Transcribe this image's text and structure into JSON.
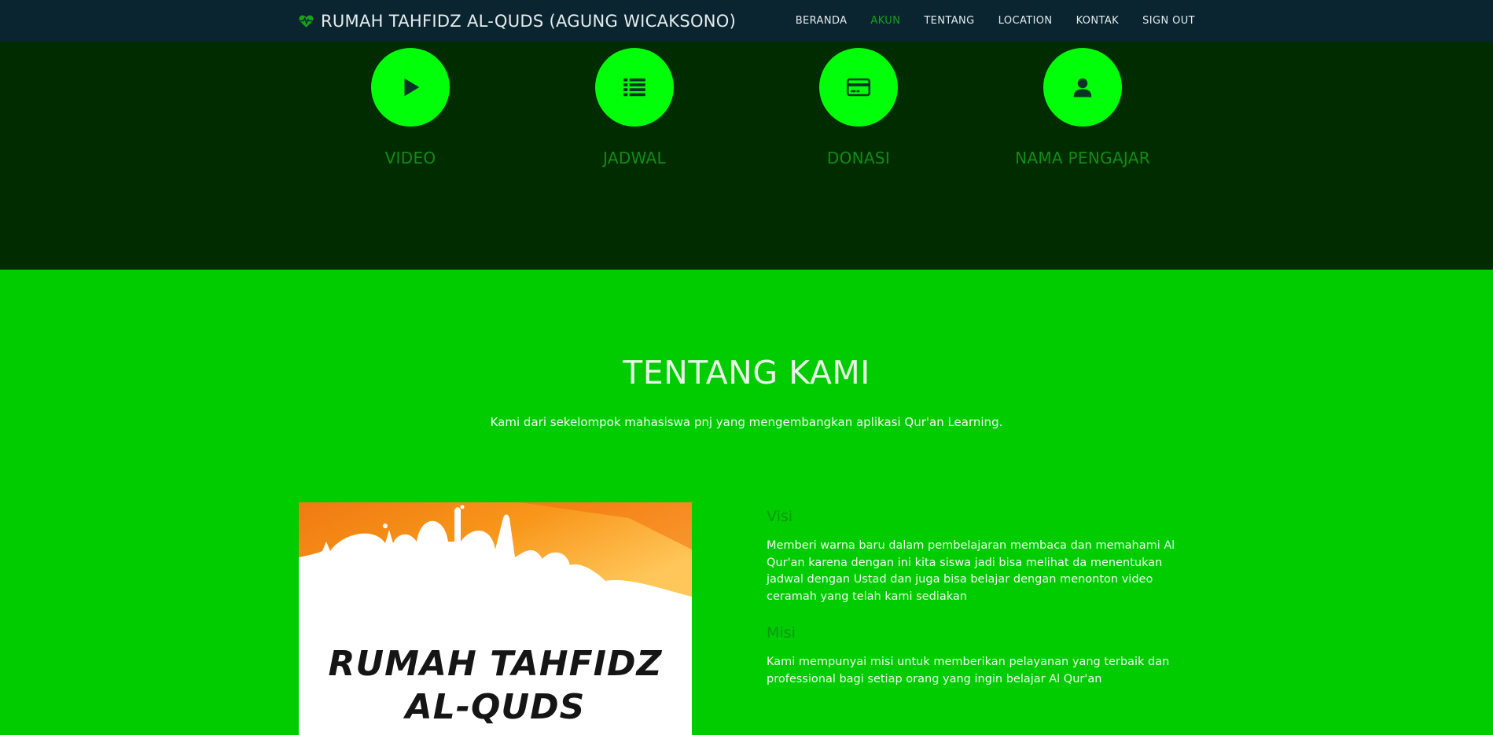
{
  "navbar": {
    "brand": "RUMAH TAHFIDZ AL-QUDS (AGUNG WICAKSONO)",
    "links": [
      {
        "label": "BERANDA",
        "active": false
      },
      {
        "label": "AKUN",
        "active": true
      },
      {
        "label": "TENTANG",
        "active": false
      },
      {
        "label": "LOCATION",
        "active": false
      },
      {
        "label": "KONTAK",
        "active": false
      },
      {
        "label": "SIGN OUT",
        "active": false
      }
    ]
  },
  "features": [
    {
      "label": "VIDEO",
      "icon": "play-icon"
    },
    {
      "label": "JADWAL",
      "icon": "list-icon"
    },
    {
      "label": "DONASI",
      "icon": "credit-card-icon"
    },
    {
      "label": "NAMA PENGAJAR",
      "icon": "user-icon"
    }
  ],
  "about": {
    "title": "TENTANG KAMI",
    "subtitle": "Kami dari sekelompok mahasiswa pnj yang mengembangkan aplikasi Qur'an Learning.",
    "poster": {
      "line1": "RUMAH TAHFIDZ",
      "line2": "AL-QUDS"
    },
    "visi_heading": "Visi",
    "visi_text": "Memberi warna baru dalam pembelajaran membaca dan memahami Al Qur'an karena dengan ini kita siswa jadi bisa melihat da menentukan jadwal dengan Ustad dan juga bisa belajar dengan menonton video ceramah yang telah kami sediakan",
    "misi_heading": "Misi",
    "misi_text": "Kami mempunyai misi untuk memberikan pelayanan yang terbaik dan professional bagi setiap orang yang ingin belajar Al Qur'an"
  },
  "colors": {
    "navbar_bg": "#0b2530",
    "top_section_bg": "#012c00",
    "about_section_bg": "#00cc00",
    "circle": "#00ff08",
    "accent": "#17a21d"
  }
}
